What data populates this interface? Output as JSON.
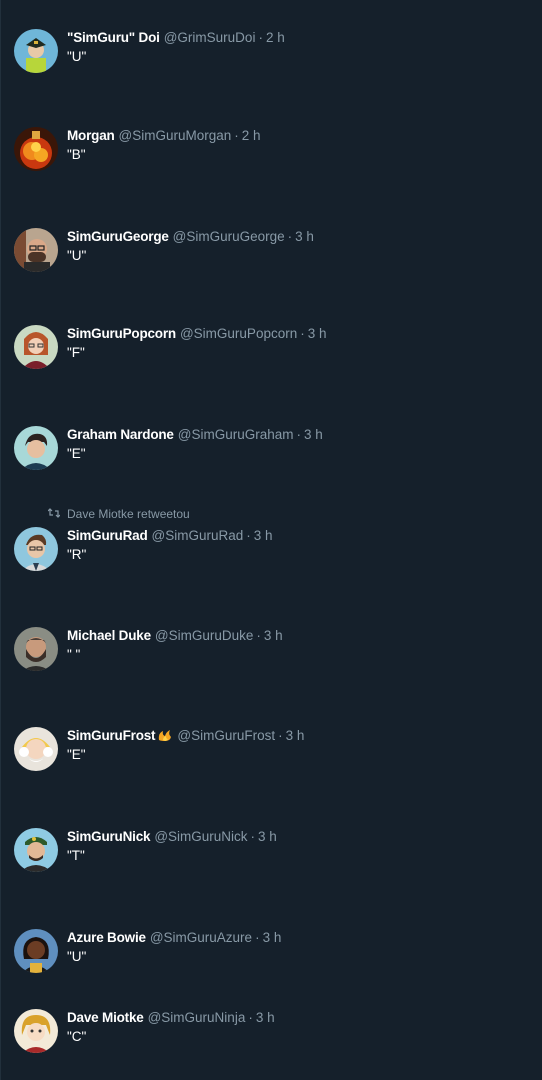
{
  "colors": {
    "background": "#15202b",
    "primary_text": "#ffffff",
    "secondary_text": "#8899a6"
  },
  "tweets": [
    {
      "name": "\"SimGuru\" Doi",
      "handle": "@GrimSuruDoi",
      "time": "2 h",
      "text": "\"U\"",
      "avatar_icon": "simguru-doi-avatar"
    },
    {
      "name": "Morgan",
      "handle": "@SimGuruMorgan",
      "time": "2 h",
      "text": "\"B\"",
      "avatar_icon": "fire-avatar"
    },
    {
      "name": "SimGuruGeorge",
      "handle": "@SimGuruGeorge",
      "time": "3 h",
      "text": "\"U\"",
      "avatar_icon": "george-avatar"
    },
    {
      "name": "SimGuruPopcorn",
      "handle": "@SimGuruPopcorn",
      "time": "3 h",
      "text": "\"F\"",
      "avatar_icon": "popcorn-avatar"
    },
    {
      "name": "Graham Nardone",
      "handle": "@SimGuruGraham",
      "time": "3 h",
      "text": "\"E\"",
      "avatar_icon": "graham-avatar"
    },
    {
      "name": "SimGuruRad",
      "handle": "@SimGuruRad",
      "time": "3 h",
      "text": "\"R\"",
      "retweet_label": "Dave Miotke retweetou",
      "avatar_icon": "rad-avatar"
    },
    {
      "name": "Michael Duke",
      "handle": "@SimGuruDuke",
      "time": "3 h",
      "text": "\" \"",
      "avatar_icon": "duke-avatar"
    },
    {
      "name": "SimGuruFrost",
      "handle": "@SimGuruFrost",
      "time": "3 h",
      "text": "\"E\"",
      "avatar_icon": "frost-avatar",
      "name_emoji": "flame-emoji"
    },
    {
      "name": "SimGuruNick",
      "handle": "@SimGuruNick",
      "time": "3 h",
      "text": "\"T\"",
      "avatar_icon": "nick-avatar"
    },
    {
      "name": "Azure Bowie",
      "handle": "@SimGuruAzure",
      "time": "3 h",
      "text": "\"U\"",
      "avatar_icon": "azure-avatar"
    },
    {
      "name": "Dave Miotke",
      "handle": "@SimGuruNinja",
      "time": "3 h",
      "text": "\"C\"",
      "avatar_icon": "ninja-avatar"
    }
  ]
}
